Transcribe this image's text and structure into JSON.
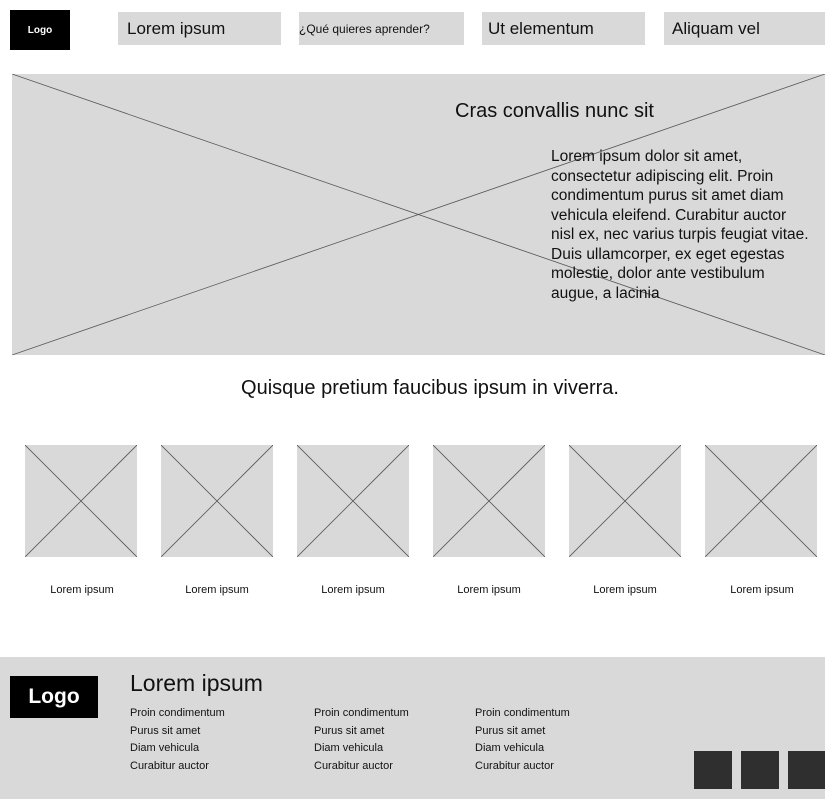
{
  "header": {
    "logo": "Logo",
    "nav": [
      "Lorem ipsum",
      "¿Qué quieres  aprender?",
      "Ut elementum",
      "Aliquam vel"
    ]
  },
  "hero": {
    "title": "Cras convallis nunc sit",
    "body": "Lorem ipsum dolor sit amet, consectetur adipiscing elit. Proin condimentum purus sit amet diam vehicula eleifend. Curabitur auctor nisl ex, nec varius turpis feugiat vitae. Duis ullamcorper, ex eget egestas molestie, dolor ante vestibulum augue, a lacinia"
  },
  "section": {
    "heading": "Quisque pretium faucibus ipsum in viverra."
  },
  "cards": [
    {
      "label": "Lorem ipsum"
    },
    {
      "label": "Lorem ipsum"
    },
    {
      "label": "Lorem ipsum"
    },
    {
      "label": "Lorem ipsum"
    },
    {
      "label": "Lorem ipsum"
    },
    {
      "label": "Lorem ipsum"
    }
  ],
  "footer": {
    "logo": "Logo",
    "title": "Lorem ipsum",
    "columns": [
      [
        "Proin condimentum",
        "Purus sit amet",
        "Diam vehicula",
        "Curabitur auctor"
      ],
      [
        "Proin condimentum",
        "Purus sit amet",
        "Diam vehicula",
        "Curabitur auctor"
      ],
      [
        "Proin condimentum",
        "Purus sit amet",
        "Diam vehicula",
        "Curabitur auctor"
      ]
    ]
  },
  "colors": {
    "placeholder": "#d9d9d9",
    "logo_bg": "#000000",
    "social_bg": "#2f2f2f"
  }
}
